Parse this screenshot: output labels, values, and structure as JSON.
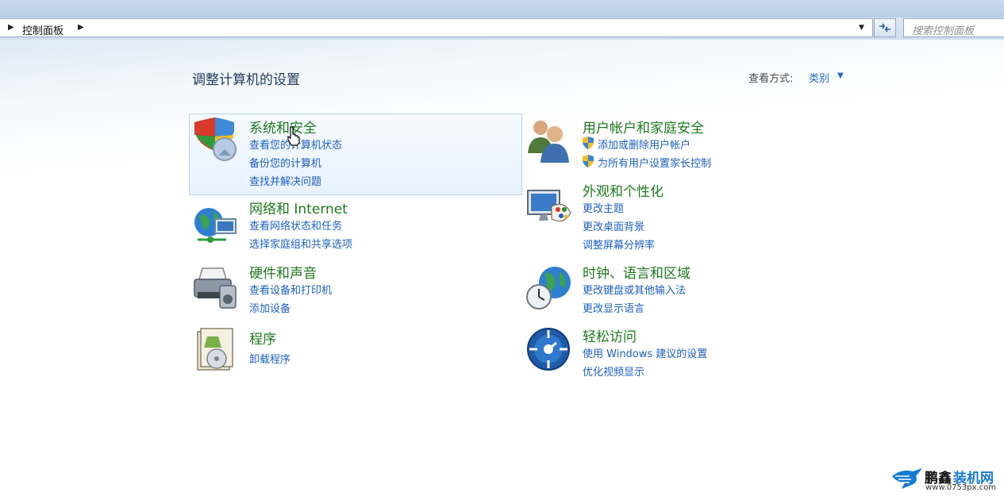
{
  "address_bar": {
    "breadcrumb": "控制面板",
    "search_placeholder": "搜索控制面板"
  },
  "main": {
    "title": "调整计算机的设置",
    "view_by_label": "查看方式:",
    "view_by_value": "类别"
  },
  "categories": [
    {
      "title": "系统和安全",
      "links": [
        "查看您的计算机状态",
        "备份您的计算机",
        "查找并解决问题"
      ],
      "icon": "shield-icon"
    },
    {
      "title": "网络和 Internet",
      "links": [
        "查看网络状态和任务",
        "选择家庭组和共享选项"
      ],
      "icon": "network-globe-icon"
    },
    {
      "title": "硬件和声音",
      "links": [
        "查看设备和打印机",
        "添加设备"
      ],
      "icon": "printer-icon"
    },
    {
      "title": "程序",
      "links": [
        "卸载程序"
      ],
      "icon": "programs-icon"
    },
    {
      "title": "用户帐户和家庭安全",
      "links": [
        "添加或删除用户帐户",
        "为所有用户设置家长控制"
      ],
      "icon": "users-icon"
    },
    {
      "title": "外观和个性化",
      "links": [
        "更改主题",
        "更改桌面背景",
        "调整屏幕分辨率"
      ],
      "icon": "monitor-palette-icon"
    },
    {
      "title": "时钟、语言和区域",
      "links": [
        "更改键盘或其他输入法",
        "更改显示语言"
      ],
      "icon": "clock-globe-icon"
    },
    {
      "title": "轻松访问",
      "links": [
        "使用 Windows 建议的设置",
        "优化视频显示"
      ],
      "icon": "ease-of-access-icon"
    }
  ],
  "watermark": {
    "name_part1": "鹏鑫",
    "name_part2": "装机网",
    "url": "www.0753px.com"
  },
  "colors": {
    "category_title": "#1d7a1d",
    "link": "#1e5fbf",
    "page_title": "#1e395b"
  }
}
